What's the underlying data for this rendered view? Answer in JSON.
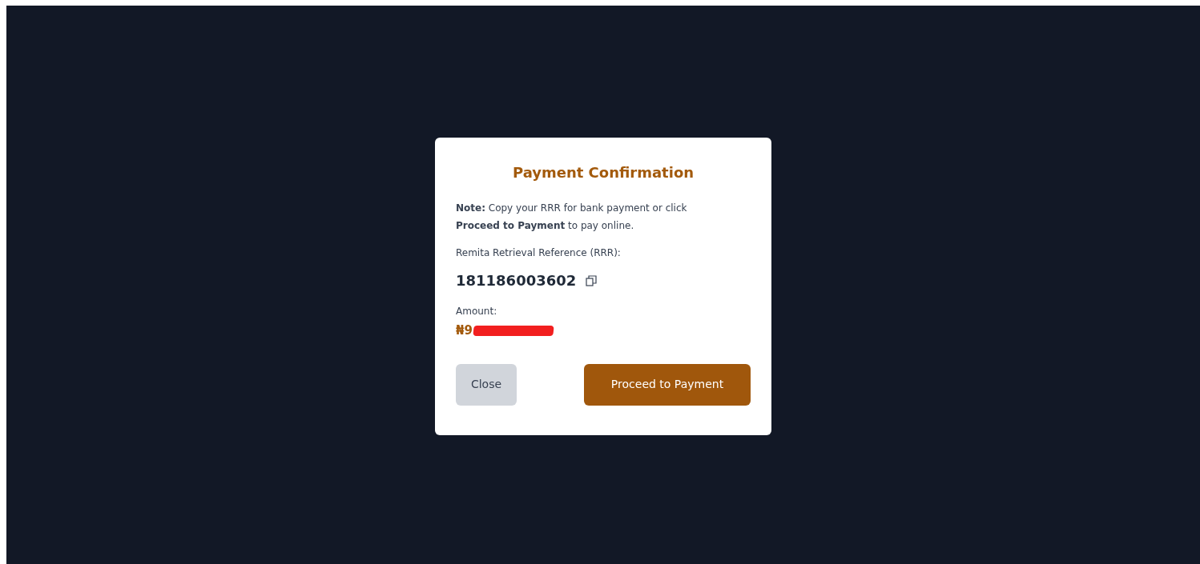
{
  "dialog": {
    "title": "Payment Confirmation",
    "note": "**Note:** Copy your RRR for bank payment or click **Proceed to Payment** to pay online.",
    "rrr_label": "Remita Retrieval Reference (RRR):",
    "rrr": "181186003602",
    "amount_label": "Amount:",
    "amount": "₦9",
    "amount_redacted": true,
    "buttons": [
      {
        "label": "Close",
        "kind": "secondary"
      },
      {
        "label": "Proceed to Payment",
        "kind": "primary"
      }
    ]
  }
}
